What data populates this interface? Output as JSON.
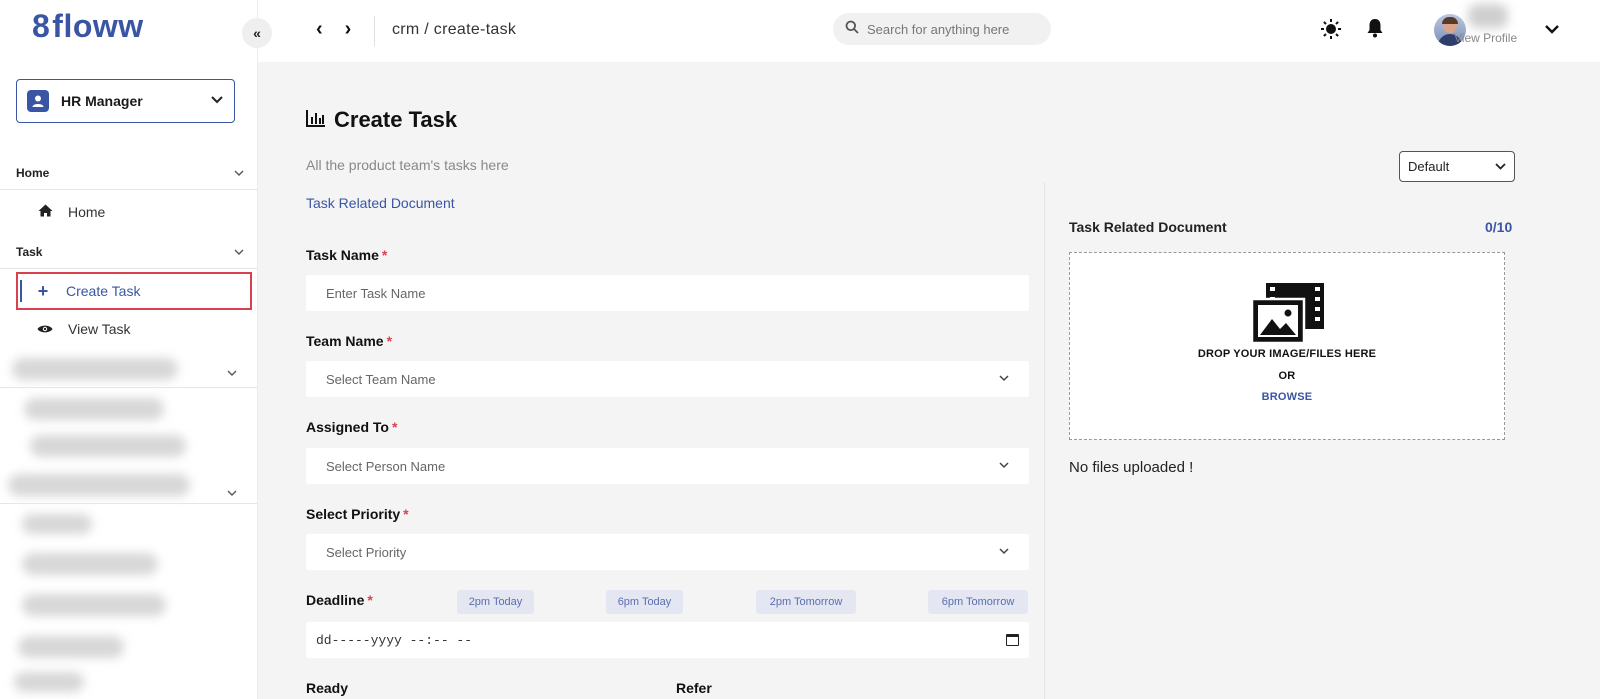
{
  "app": {
    "logo_text": "floww"
  },
  "sidebar": {
    "collapse_glyph": "«",
    "role": {
      "label": "HR Manager"
    },
    "sections": [
      {
        "label": "Home",
        "items": [
          {
            "label": "Home",
            "icon": "home-icon"
          }
        ]
      },
      {
        "label": "Task",
        "items": [
          {
            "label": "Create Task",
            "icon": "plus-icon",
            "active": true
          },
          {
            "label": "View Task",
            "icon": "eye-icon"
          }
        ]
      }
    ]
  },
  "topbar": {
    "back_glyph": "‹",
    "forward_glyph": "›",
    "breadcrumb": "crm / create-task",
    "search_placeholder": "Search for anything here",
    "view_profile": "View Profile"
  },
  "main": {
    "title": "Create Task",
    "subtitle": "All the product team's tasks here",
    "doc_link": "Task Related Document",
    "sort_select": "Default",
    "fields": {
      "task_name": {
        "label": "Task Name",
        "placeholder": "Enter Task Name"
      },
      "team_name": {
        "label": "Team Name",
        "placeholder": "Select Team Name"
      },
      "assigned_to": {
        "label": "Assigned To",
        "placeholder": "Select Person Name"
      },
      "priority": {
        "label": "Select Priority",
        "placeholder": "Select Priority"
      },
      "deadline": {
        "label": "Deadline",
        "value": "dd-----yyyy --:-- --"
      }
    },
    "required_mark": "*",
    "deadline_chips": [
      "2pm Today",
      "6pm Today",
      "2pm Tomorrow",
      "6pm Tomorrow"
    ],
    "cut_labels": [
      "Ready",
      "Refer"
    ]
  },
  "documents": {
    "title": "Task Related Document",
    "count": "0/10",
    "drop_text": "DROP YOUR IMAGE/FILES HERE",
    "or_text": "OR",
    "browse_text": "BROWSE",
    "no_files": "No files uploaded !"
  },
  "colors": {
    "accent": "#3a55a4",
    "required": "#d9414f",
    "active_outline": "#d9414f",
    "chip_bg": "#e4e7f2"
  }
}
